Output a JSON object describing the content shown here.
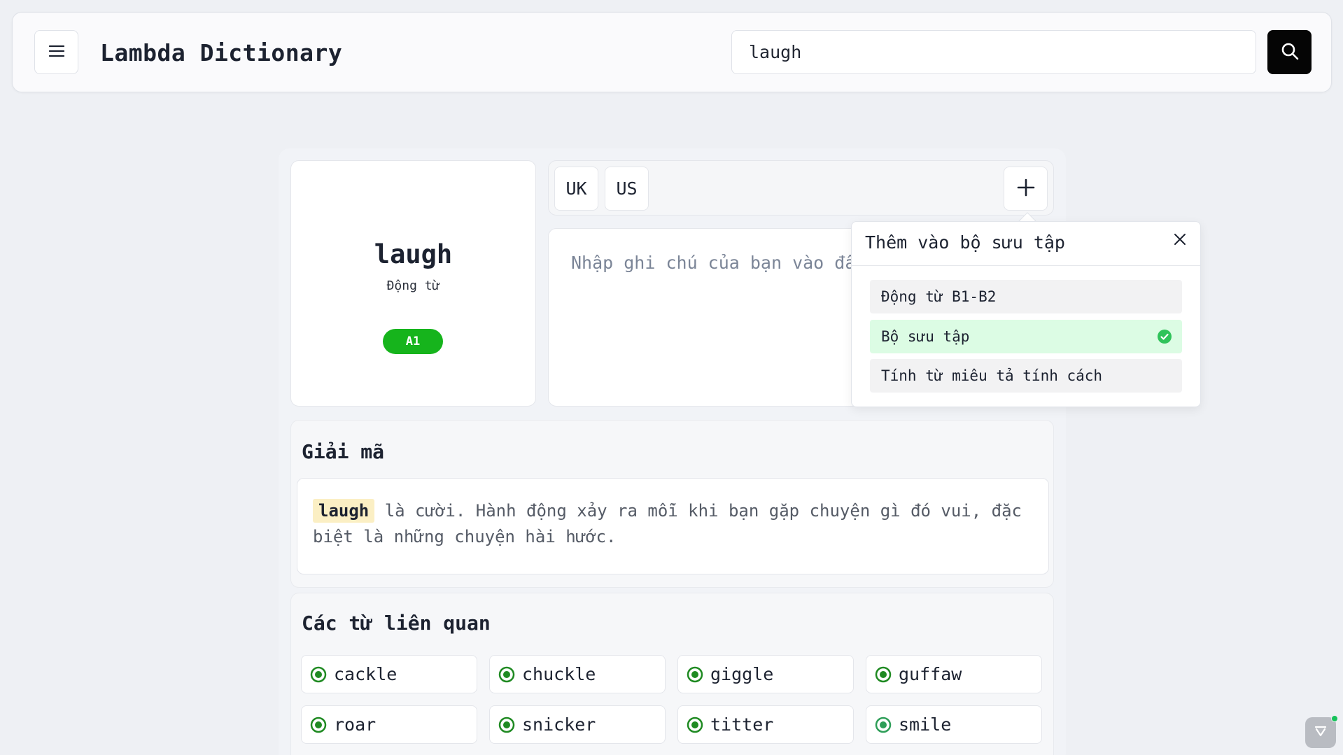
{
  "app": {
    "brand": "Lambda Dictionary"
  },
  "search": {
    "value": "laugh"
  },
  "word": {
    "text": "laugh",
    "part_of_speech": "Động từ",
    "level": "A1"
  },
  "pronunciation": {
    "buttons": [
      "UK",
      "US"
    ]
  },
  "note": {
    "placeholder": "Nhập ghi chú của bạn vào đây"
  },
  "decode": {
    "title": "Giải mã",
    "highlight": "laugh",
    "text": "là cười. Hành động xảy ra mỗi khi bạn gặp chuyện gì đó vui, đặc biệt là những chuyện hài hước."
  },
  "related": {
    "title": "Các từ liên quan",
    "items": [
      "cackle",
      "chuckle",
      "giggle",
      "guffaw",
      "roar",
      "snicker",
      "titter",
      "smile"
    ]
  },
  "popover": {
    "title": "Thêm vào bộ sưu tập",
    "items": [
      {
        "label": "Động từ B1-B2",
        "selected": false
      },
      {
        "label": "Bộ sưu tập",
        "selected": true
      },
      {
        "label": "Tính từ miêu tả tính cách",
        "selected": false
      }
    ]
  },
  "colors": {
    "level_badge": "#16b41c",
    "selected_collection": "#dcfce4",
    "check": "#2fc35a",
    "related_icon": "#1f8a22",
    "highlight": "#fbefc4"
  }
}
